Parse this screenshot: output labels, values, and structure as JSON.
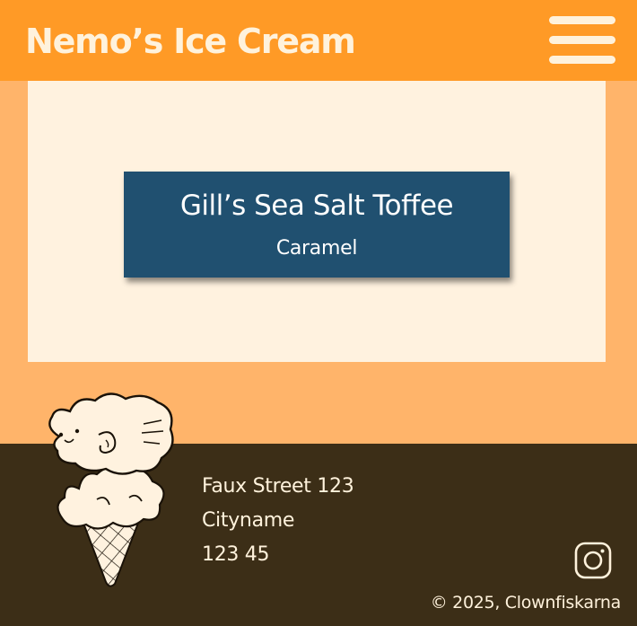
{
  "header": {
    "site_title": "Nemo’s Ice Cream",
    "menu_icon": "hamburger-menu-icon"
  },
  "flavor": {
    "name": "Gill’s Sea Salt Toffee",
    "type": "Caramel"
  },
  "footer": {
    "address": {
      "street": "Faux Street 123",
      "city": "Cityname",
      "postal_code": "123 45"
    },
    "copyright": "© 2025, Clownfiskarna",
    "social_icon": "instagram-icon",
    "mascot_icon": "ice-cream-cone-mascot"
  },
  "colors": {
    "header_bg": "#FF9A26",
    "page_bg": "#FFB46A",
    "card_area_bg": "#FFF2DF",
    "flavor_card_bg": "#205070",
    "footer_bg": "#3C2E17",
    "light_text": "#FFF2DC"
  }
}
